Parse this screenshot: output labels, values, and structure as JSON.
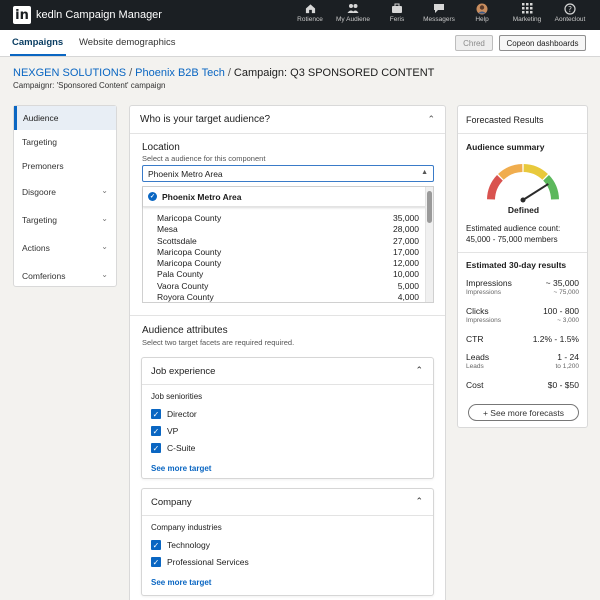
{
  "app": {
    "logo": "in",
    "title": "kedln Campaign Manager"
  },
  "nav": [
    {
      "label": "Rotience",
      "icon": "home-icon"
    },
    {
      "label": "My Audiene",
      "icon": "people-icon"
    },
    {
      "label": "Feris",
      "icon": "briefcase-icon"
    },
    {
      "label": "Messagers",
      "icon": "chat-icon"
    },
    {
      "label": "Help",
      "icon": "avatar-icon"
    },
    {
      "label": "Marketing",
      "icon": "grid-icon"
    },
    {
      "label": "Aonteclout",
      "icon": "help-icon"
    }
  ],
  "tabs": {
    "campaigns": "Campaigns",
    "website_demographics": "Website demographics",
    "chred": "Chred",
    "copeon_dashboards": "Copeon dashboards"
  },
  "breadcrumb": {
    "org": "NEXGEN SOLUTIONS",
    "group": "Phoenix B2B Tech",
    "campaign": "Campaign: Q3 SPONSORED CONTENT"
  },
  "campaign_sub": "Campaignr: 'Sponsored Content' campaign",
  "leftnav": [
    {
      "label": "Audience",
      "active": true,
      "chevron": false
    },
    {
      "label": "Targeting",
      "active": false,
      "chevron": false
    },
    {
      "label": "Premoners",
      "active": false,
      "chevron": false
    },
    {
      "label": "Disgoore",
      "active": false,
      "chevron": true
    },
    {
      "label": "Targeting",
      "active": false,
      "chevron": true
    },
    {
      "label": "Actions",
      "active": false,
      "chevron": true
    },
    {
      "label": "Comferions",
      "active": false,
      "chevron": true
    }
  ],
  "main": {
    "question": "Who is your target audience?",
    "location": {
      "title": "Location",
      "subtitle": "Select a audience for this component",
      "selected": "Phoenix Metro Area",
      "dropdown_selected": "Phoenix Metro Area",
      "rows": [
        {
          "name": "Maricopa County",
          "count": "35,000"
        },
        {
          "name": "Mesa",
          "count": "28,000"
        },
        {
          "name": "Scottsdale",
          "count": "27,000"
        },
        {
          "name": "Maricopa County",
          "count": "17,000"
        },
        {
          "name": "Maricopa County",
          "count": "12,000"
        },
        {
          "name": "Pala County",
          "count": "10,000"
        },
        {
          "name": "Vaora County",
          "count": "5,000"
        },
        {
          "name": "Royora County",
          "count": "4,000"
        }
      ]
    },
    "attributes": {
      "title": "Audience attributes",
      "subtitle": "Select two target facets are required required."
    },
    "job_experience": {
      "title": "Job experience",
      "label": "Job seniorities",
      "options": [
        "Director",
        "VP",
        "C-Suite"
      ],
      "see_more": "See more target"
    },
    "company": {
      "title": "Company",
      "label": "Company industries",
      "options": [
        "Technology",
        "Professional Services"
      ],
      "see_more": "See more target"
    }
  },
  "forecast": {
    "title": "Forecasted Results",
    "summary_title": "Audience summary",
    "gauge_label": "Defined",
    "gauge_level": 0.82,
    "count_label": "Estimated audience count:",
    "count_value": "45,000 - 75,000 members",
    "results_title": "Estimated 30-day results",
    "rows": [
      {
        "label": "Impressions",
        "value": "~ 35,000",
        "sub_label": "Impressions",
        "sub_value": "~ 75,000"
      },
      {
        "label": "Clicks",
        "value": "100 - 800",
        "sub_label": "Impressions",
        "sub_value": "~ 3,000"
      },
      {
        "label": "CTR",
        "value": "1.2% - 1.5%",
        "sub_label": "",
        "sub_value": ""
      },
      {
        "label": "Leads",
        "value": "1 - 24",
        "sub_label": "Leads",
        "sub_value": "to 1,200"
      },
      {
        "label": "Cost",
        "value": "$0 - $50",
        "sub_label": "",
        "sub_value": ""
      }
    ],
    "see_more": "+ See more forecasts"
  },
  "colors": {
    "topbar": "#1b1f23",
    "accent": "#0a66c2",
    "gauge": [
      "#d9534f",
      "#f0ad4e",
      "#e8c93c",
      "#5cb85c"
    ]
  }
}
